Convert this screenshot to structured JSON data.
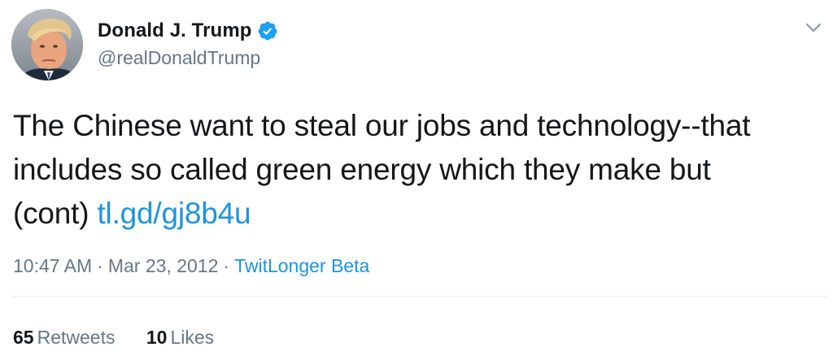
{
  "author": {
    "display_name": "Donald J. Trump",
    "handle": "@realDonaldTrump",
    "verified": true,
    "avatar_icon": "profile-photo"
  },
  "tweet": {
    "lines": [
      "The Chinese want to steal our jobs and technology--that",
      "includes so called green energy which they make but",
      "(cont) "
    ],
    "link_text": "tl.gd/gj8b4u"
  },
  "meta": {
    "time": "10:47 AM",
    "date": "Mar 23, 2012",
    "source": "TwitLonger Beta",
    "separator": "·"
  },
  "stats": {
    "retweets_count": "65",
    "retweets_label": "Retweets",
    "likes_count": "10",
    "likes_label": "Likes"
  },
  "colors": {
    "link": "#1b95e0",
    "secondary_text": "#657786",
    "primary_text": "#14171a",
    "verified_badge": "#1da1f2",
    "divider": "#e1e8ed"
  },
  "icons": {
    "verified": "verified-badge-icon",
    "menu": "chevron-down-icon"
  }
}
